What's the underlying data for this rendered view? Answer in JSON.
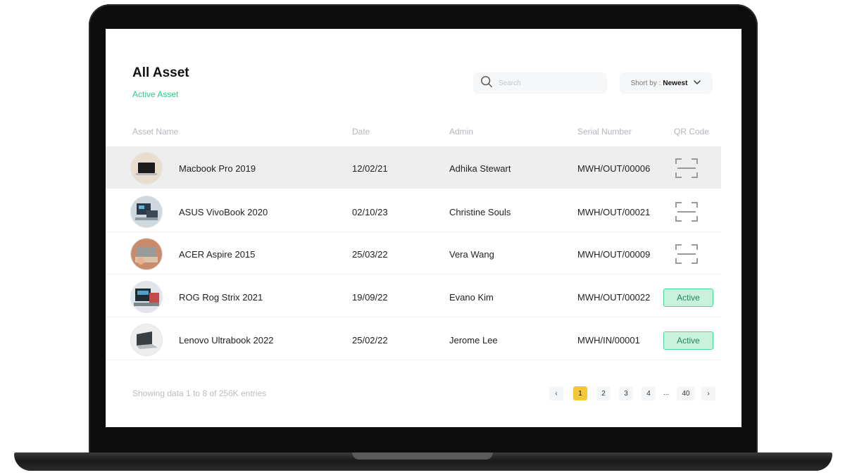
{
  "header": {
    "title": "All Asset",
    "subtitle": "Active Asset"
  },
  "search": {
    "placeholder": "Search",
    "icon": "search-icon"
  },
  "sort": {
    "label": "Short by :",
    "value": "Newest"
  },
  "table": {
    "columns": [
      "Asset Name",
      "Date",
      "Admin",
      "Serial Number",
      "QR Code"
    ],
    "rows": [
      {
        "name": "Macbook Pro 2019",
        "date": "12/02/21",
        "admin": "Adhika Stewart",
        "serial": "MWH/OUT/00006",
        "qr": "qr-scan-icon"
      },
      {
        "name": "ASUS VivoBook 2020",
        "date": "02/10/23",
        "admin": "Christine Souls",
        "serial": "MWH/OUT/00021",
        "qr": "qr-scan-icon"
      },
      {
        "name": "ACER Aspire 2015",
        "date": "25/03/22",
        "admin": "Vera Wang",
        "serial": "MWH/OUT/00009",
        "qr": "qr-scan-icon"
      },
      {
        "name": "ROG Rog Strix 2021",
        "date": "19/09/22",
        "admin": "Evano Kim",
        "serial": "MWH/OUT/00022",
        "status": "Active"
      },
      {
        "name": "Lenovo Ultrabook 2022",
        "date": "25/02/22",
        "admin": "Jerome Lee",
        "serial": "MWH/IN/00001",
        "status": "Active"
      }
    ]
  },
  "footer": {
    "summary": "Showing data 1 to 8 of  256K entries",
    "pagination": {
      "prev": "‹",
      "pages": [
        "1",
        "2",
        "3",
        "4"
      ],
      "ellipsis": "...",
      "last": "40",
      "next": "›",
      "current": "1"
    }
  },
  "colors": {
    "accent": "#2fc98a",
    "active_page": "#f6c634",
    "badge_bg": "#c9f1de",
    "badge_border": "#4ed39b"
  }
}
